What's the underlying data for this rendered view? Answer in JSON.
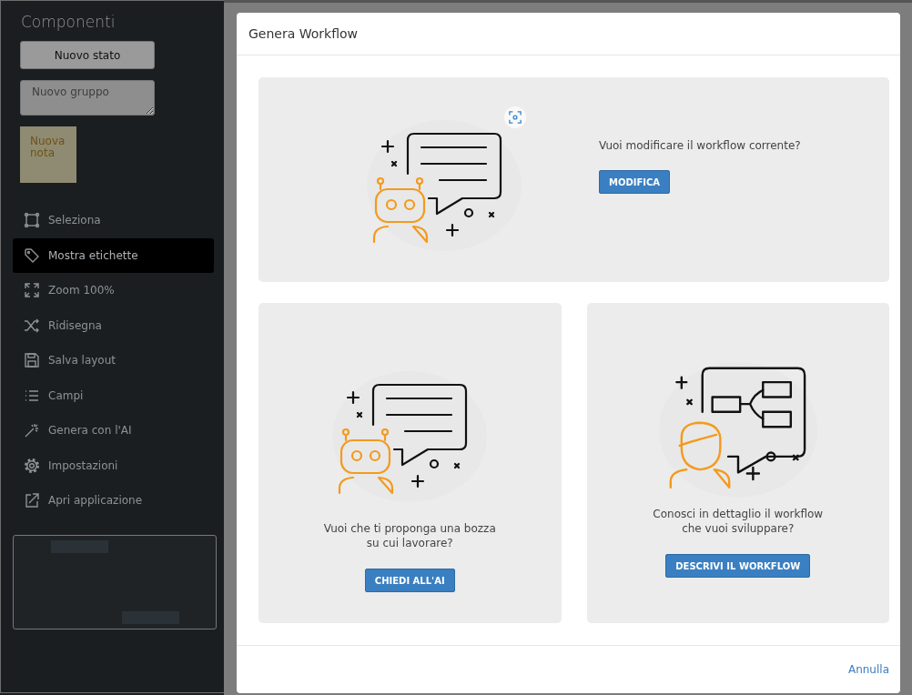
{
  "sidebar": {
    "title": "Componenti",
    "new_state_button": "Nuovo stato",
    "new_group_field": {
      "placeholder": "Nuovo gruppo"
    },
    "new_note": "Nuova nota",
    "items": [
      {
        "label": "Seleziona",
        "selected": false
      },
      {
        "label": "Mostra etichette",
        "selected": true
      },
      {
        "label": "Zoom 100%",
        "selected": false
      },
      {
        "label": "Ridisegna",
        "selected": false
      },
      {
        "label": "Salva layout",
        "selected": false
      },
      {
        "label": "Campi",
        "selected": false
      },
      {
        "label": "Genera con l'AI",
        "selected": false
      },
      {
        "label": "Impostazioni",
        "selected": false
      },
      {
        "label": "Apri applicazione",
        "selected": false
      }
    ]
  },
  "dialog": {
    "title": "Genera Workflow",
    "top_card": {
      "kind": "robot",
      "text": "Vuoi modificare il workflow corrente?",
      "button": "MODIFICA"
    },
    "option_cards": [
      {
        "kind": "robot",
        "text": "Vuoi che ti proponga una bozza\nsu cui lavorare?",
        "button": "CHIEDI ALL'AI"
      },
      {
        "kind": "person",
        "text": "Conosci in dettaglio il workflow\nche vuoi sviluppare?",
        "button": "DESCRIVI IL WORKFLOW"
      }
    ],
    "cancel_link": "Annulla"
  }
}
